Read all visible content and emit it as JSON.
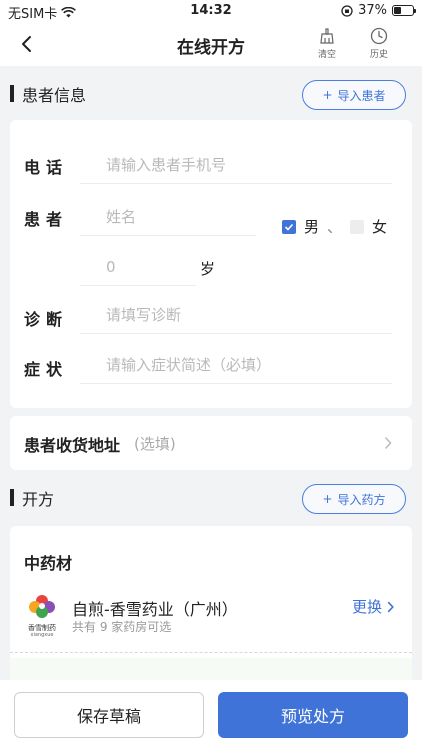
{
  "status": {
    "carrier": "无SIM卡",
    "time": "14:32",
    "battery": "37%",
    "battery_level": 0.37
  },
  "nav": {
    "title": "在线开方",
    "clear_label": "清空",
    "history_label": "历史"
  },
  "patient_section": {
    "title": "患者信息",
    "import_label": "导入患者"
  },
  "form": {
    "phone_label": "电话",
    "phone_placeholder": "请输入患者手机号",
    "patient_label": "患者",
    "name_placeholder": "姓名",
    "gender_male": "男",
    "gender_sep": "、",
    "gender_female": "女",
    "age_value": "0",
    "age_unit": "岁",
    "diagnosis_label": "诊断",
    "diagnosis_placeholder": "请填写诊断",
    "symptom_label": "症状",
    "symptom_placeholder": "请输入症状简述（必填）"
  },
  "address": {
    "label": "患者收货地址",
    "optional": "(选填)"
  },
  "prescription_section": {
    "title": "开方",
    "import_label": "导入药方"
  },
  "herbal": {
    "title": "中药材",
    "logo_text": "香雪制药",
    "logo_sub": "xiangxue",
    "provider_name": "自煎-香雪药业（广州）",
    "provider_sub": "共有 9 家药房可选",
    "change_label": "更换"
  },
  "actions": {
    "save_draft": "保存草稿",
    "preview": "预览处方"
  }
}
